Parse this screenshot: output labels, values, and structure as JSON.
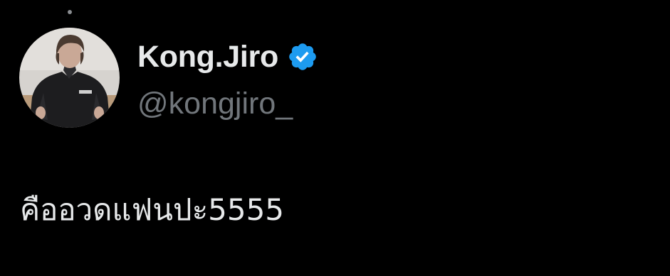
{
  "tweet": {
    "author": {
      "display_name": "Kong.Jiro",
      "handle": "@kongjiro_",
      "verified": true,
      "verified_icon": "verified-badge-icon",
      "avatar_icon": "profile-photo"
    },
    "text": "คืออวดแฟนปะ5555"
  },
  "colors": {
    "background": "#000000",
    "primary_text": "#e7e9ea",
    "secondary_text": "#71767b",
    "verified_blue": "#1d9bf0"
  }
}
